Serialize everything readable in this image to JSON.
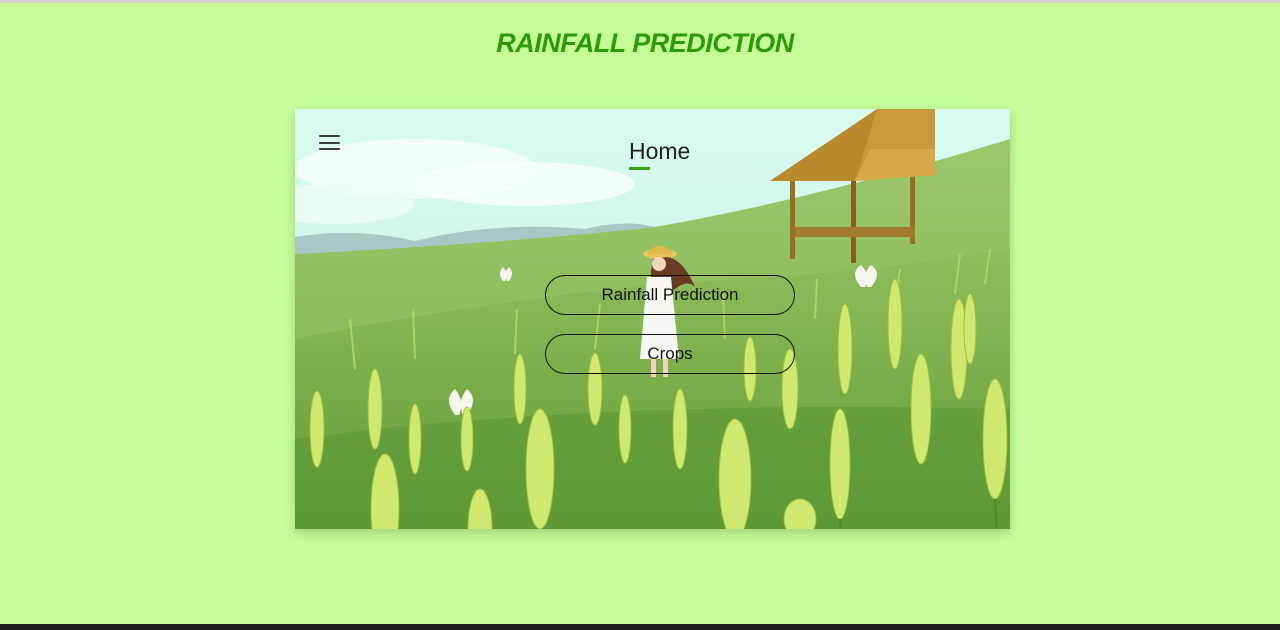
{
  "page": {
    "title": "RAINFALL PREDICTION",
    "background_color": "#c5fc98",
    "title_color": "#2e9a09"
  },
  "card": {
    "nav": {
      "menu_icon": "hamburger-menu-icon",
      "home_label": "Home"
    },
    "buttons": {
      "rainfall_label": "Rainfall Prediction",
      "crops_label": "Crops"
    },
    "illustration": "wheat-field-girl-hut-illustration"
  }
}
